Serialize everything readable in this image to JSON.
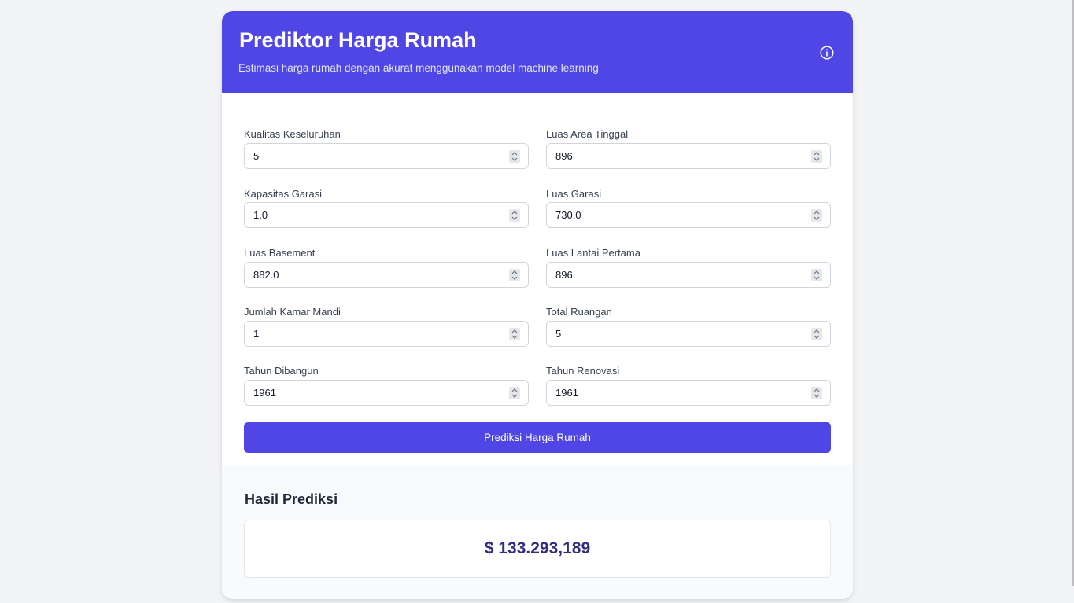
{
  "header": {
    "title": "Prediktor Harga Rumah",
    "subtitle": "Estimasi harga rumah dengan akurat menggunakan model machine learning"
  },
  "fields": [
    {
      "label": "Kualitas Keseluruhan",
      "value": "5"
    },
    {
      "label": "Luas Area Tinggal",
      "value": "896"
    },
    {
      "label": "Kapasitas Garasi",
      "value": "1.0"
    },
    {
      "label": "Luas Garasi",
      "value": "730.0"
    },
    {
      "label": "Luas Basement",
      "value": "882.0"
    },
    {
      "label": "Luas Lantai Pertama",
      "value": "896"
    },
    {
      "label": "Jumlah Kamar Mandi",
      "value": "1"
    },
    {
      "label": "Total Ruangan",
      "value": "5"
    },
    {
      "label": "Tahun Dibangun",
      "value": "1961"
    },
    {
      "label": "Tahun Renovasi",
      "value": "1961"
    }
  ],
  "submit": {
    "label": "Prediksi Harga Rumah"
  },
  "result": {
    "title": "Hasil Prediksi",
    "value": "$ 133.293,189"
  },
  "icons": {
    "info": "info-icon",
    "spinner": "spinner-icon"
  },
  "colors": {
    "accent": "#4f46e5",
    "result_text": "#312e81"
  }
}
